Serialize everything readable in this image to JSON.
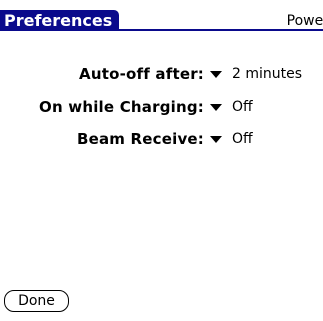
{
  "header": {
    "title": "Preferences",
    "category": "Power"
  },
  "settings": [
    {
      "label": "Auto-off after:",
      "value": "2 minutes"
    },
    {
      "label": "On while Charging:",
      "value": "Off"
    },
    {
      "label": "Beam Receive:",
      "value": "Off"
    }
  ],
  "footer": {
    "done_label": "Done"
  },
  "colors": {
    "title_background": "#0a0a8c",
    "title_text": "#ffffff",
    "background": "#ffffff",
    "text": "#000000"
  },
  "icons": {
    "picker": "triangle-down-icon"
  }
}
